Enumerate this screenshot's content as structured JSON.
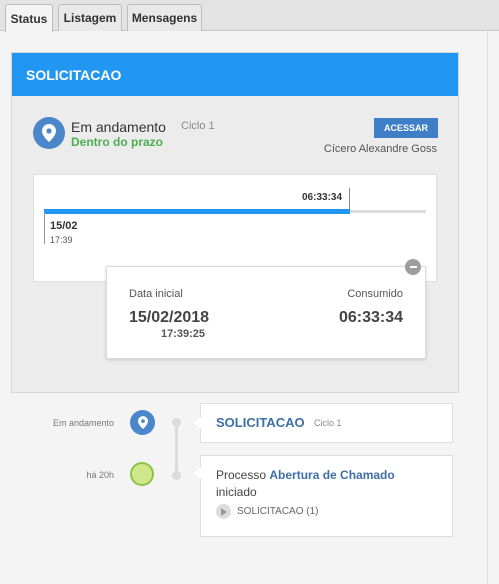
{
  "tabs": [
    {
      "label": "Status",
      "active": true
    },
    {
      "label": "Listagem",
      "active": false
    },
    {
      "label": "Mensagens",
      "active": false
    }
  ],
  "card": {
    "header": "SOLICITACAO",
    "status_title": "Em andamento",
    "cycle": "Ciclo 1",
    "status_sub": "Dentro do prazo",
    "access_button": "ACESSAR",
    "user": "Cícero Alexandre Goss",
    "icon": "location-pin-icon"
  },
  "timeline": {
    "elapsed": "06:33:34",
    "start_date": "15/02",
    "start_hour": "17:39",
    "progress": 0.8
  },
  "popover": {
    "start_label": "Data inicial",
    "consumed_label": "Consumido",
    "start_date": "15/02/2018",
    "start_time": "17:39:25",
    "consumed": "06:33:34"
  },
  "history": [
    {
      "time_label": "Em andamento",
      "title": "SOLICITACAO",
      "cycle": "Ciclo 1",
      "icon": "location-pin-icon"
    },
    {
      "time_label": "há 20h",
      "line_prefix": "Processo ",
      "link": "Abertura de Chamado",
      "line2": "iniciado",
      "sub": "SOLICITACAO (1)",
      "icon": "start-circle-icon"
    }
  ],
  "colors": {
    "accent": "#2196f3",
    "success": "#4caf50",
    "link": "#3f6fa8"
  }
}
